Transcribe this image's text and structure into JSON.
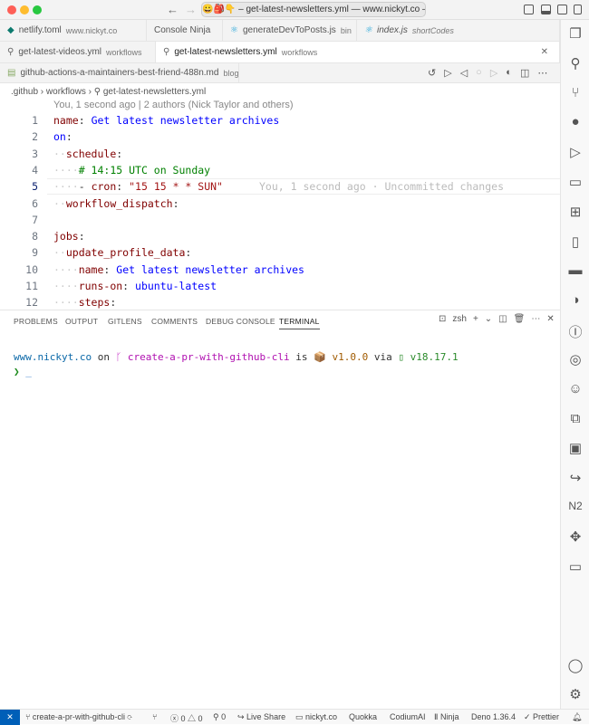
{
  "window": {
    "title": "😀🎒👇 – get-latest-newsletters.yml — www.nickyt.co – 👇🎒",
    "colors": {
      "close": "#fe5f57",
      "minimize": "#febc2e",
      "maximize": "#28c840"
    }
  },
  "tabs_row1": [
    {
      "label": "netlify.toml",
      "desc": "www.nickyt.co",
      "icon": "netlify-icon"
    },
    {
      "label": "Console Ninja",
      "desc": ""
    },
    {
      "label": "generateDevToPosts.js",
      "desc": "bin",
      "icon": "react-icon"
    },
    {
      "label": "index.js",
      "desc": "shortCodes",
      "icon": "react-icon"
    }
  ],
  "tabs_row2": [
    {
      "label": "get-latest-videos.yml",
      "desc": "workflows"
    },
    {
      "label": "get-latest-newsletters.yml",
      "desc": "workflows",
      "active": true
    }
  ],
  "tabs_row3": [
    {
      "label": "github-actions-a-maintainers-best-friend-488n.md",
      "desc": "blog"
    }
  ],
  "breadcrumb": [
    ".github",
    "workflows",
    "get-latest-newsletters.yml"
  ],
  "codelens": "You, 1 second ago | 2 authors (Nick Taylor and others)",
  "code": {
    "numbers": [
      "1",
      "2",
      "3",
      "4",
      "5",
      "6",
      "7",
      "8",
      "9",
      "10",
      "11",
      "12"
    ],
    "blame": "You, 1 second ago · Uncommitted changes",
    "l1k": "name",
    "l1v": "Get latest newsletter archives",
    "l2k": "on",
    "l3k": "schedule",
    "l4c": "# 14:15 UTC on Sunday",
    "l5k": "cron",
    "l5v": "\"15 15 * * SUN\"",
    "l6k": "workflow_dispatch",
    "l8k": "jobs",
    "l9k": "update_profile_data",
    "l10k": "name",
    "l10v": "Get latest newsletter archives",
    "l11k": "runs-on",
    "l11v": "ubuntu-latest",
    "l12k": "steps"
  },
  "panel": {
    "tabs": [
      "PROBLEMS",
      "OUTPUT",
      "GITLENS",
      "COMMENTS",
      "DEBUG CONSOLE",
      "TERMINAL"
    ],
    "active": "TERMINAL",
    "shell": "zsh"
  },
  "terminal": {
    "dir": "www.nickyt.co",
    "on": "on",
    "branch": "create-a-pr-with-github-cli",
    "is": "is",
    "pkg": "v1.0.0",
    "via": "via",
    "node": "v18.17.1",
    "prompt": "❯"
  },
  "status": {
    "branch": "create-a-pr-with-github-cli",
    "errors": "0",
    "warnings": "0",
    "ports": "0",
    "live_share": "Live Share",
    "workspace": "nickyt.co",
    "quokka": "Quokka",
    "codium": "CodiumAI",
    "ninja": "Ninja",
    "deno": "Deno 1.36.4",
    "prettier": "Prettier"
  }
}
